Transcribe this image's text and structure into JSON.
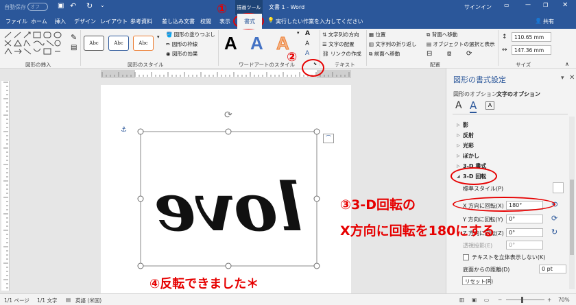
{
  "titlebar": {
    "autosave_label": "自動保存",
    "autosave_state": "オフ",
    "drawing_tools": "描画ツール",
    "document_title": "文書 1 - Word",
    "signin": "サインイン"
  },
  "tabs": [
    "ファイル",
    "ホーム",
    "挿入",
    "デザイン",
    "レイアウト",
    "参考資料",
    "差し込み文書",
    "校閲",
    "表示"
  ],
  "active_tab": "書式",
  "tell_me": "実行したい作業を入力してください",
  "share": "共有",
  "ribbon": {
    "insert_shapes_label": "図形の挿入",
    "shape_styles_label": "図形のスタイル",
    "style_sample": "Abc",
    "shape_fill": "図形の塗りつぶし",
    "shape_outline": "図形の枠線",
    "shape_effects": "図形の効果",
    "wordart_styles_label": "ワードアートのスタイル",
    "wordart_sample": "A",
    "text_direction": "文字列の方向",
    "align_text": "文字の配置",
    "create_link": "リンクの作成",
    "text_label": "テキスト",
    "position": "位置",
    "wrap_text": "文字列の折り返し",
    "bring_forward": "前面へ移動",
    "send_backward": "背面へ移動",
    "selection_pane": "オブジェクトの選択と表示",
    "arrange_label": "配置",
    "height": "110.65 mm",
    "width": "147.36 mm",
    "size_label": "サイズ"
  },
  "pane": {
    "title": "図形の書式設定",
    "tab_shape_options": "図形のオプション",
    "tab_text_options": "文字のオプション",
    "sections": [
      "影",
      "反射",
      "光彩",
      "ぼかし",
      "3-D 書式"
    ],
    "rotation_section": "3-D 回転",
    "preset": "標準スタイル(P)",
    "x_rotation_label": "X 方向に回転(X)",
    "x_rotation_value": "180°",
    "y_rotation_label": "Y 方向に回転(Y)",
    "y_rotation_value": "0°",
    "z_rotation_label": "Z 方向に回転(Z)",
    "z_rotation_value": "0°",
    "perspective_label": "透視投影(E)",
    "perspective_value": "0°",
    "keep_flat": "テキストを立体表示しない(K)",
    "distance_label": "底面からの距離(D)",
    "distance_value": "0 pt",
    "reset": "リセット(R)"
  },
  "document": {
    "wordart_text": "love"
  },
  "annotations": {
    "a1": "①",
    "a2": "②",
    "a3_line1": "③3-D回転の",
    "a3_line2": "X方向に回転を180にする",
    "a4": "④反転できました＊"
  },
  "status": {
    "page": "1/1 ページ",
    "words": "1/1 文字",
    "language": "英語 (米国)",
    "zoom": "70%"
  },
  "colors": {
    "word_blue": "#2b579a",
    "annotation_red": "#e60000",
    "pane_heading_blue": "#2b579a"
  }
}
